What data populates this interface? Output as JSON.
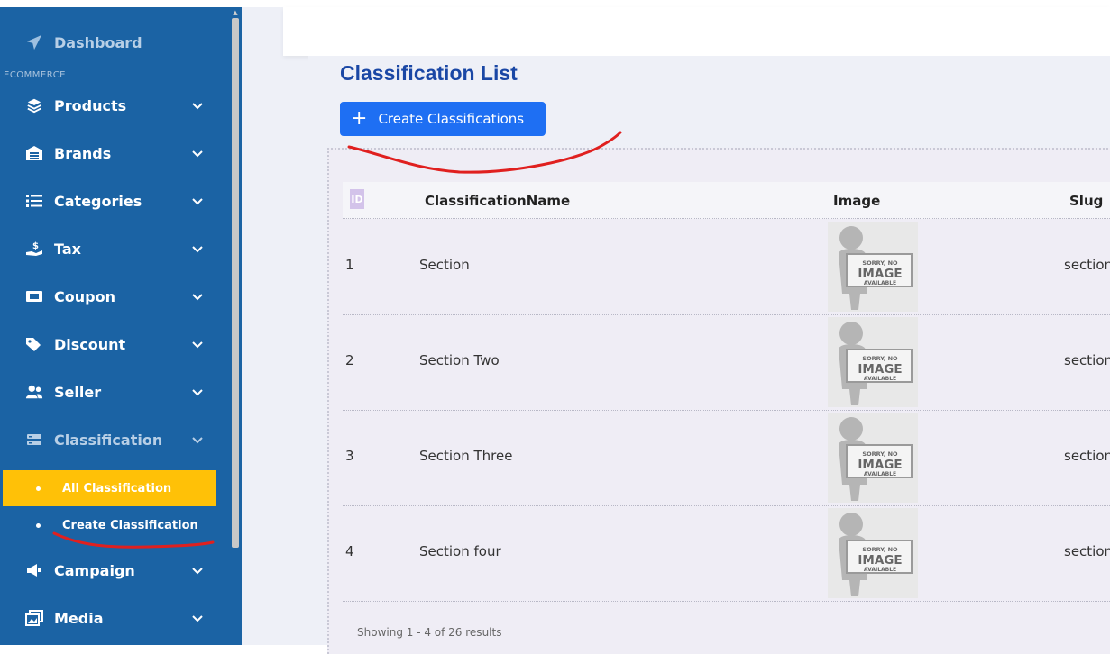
{
  "sidebar": {
    "dashboard": "Dashboard",
    "section": "ECOMMERCE",
    "items": [
      {
        "label": "Products",
        "icon": "layers-icon"
      },
      {
        "label": "Brands",
        "icon": "warehouse-icon"
      },
      {
        "label": "Categories",
        "icon": "list-icon"
      },
      {
        "label": "Tax",
        "icon": "hand-dollar-icon"
      },
      {
        "label": "Coupon",
        "icon": "ticket-icon"
      },
      {
        "label": "Discount",
        "icon": "tags-icon"
      },
      {
        "label": "Seller",
        "icon": "users-icon"
      },
      {
        "label": "Classification",
        "icon": "server-icon"
      },
      {
        "label": "Campaign",
        "icon": "megaphone-icon"
      },
      {
        "label": "Media",
        "icon": "images-icon"
      }
    ],
    "sub_items": [
      "All Classification",
      "Create Classification"
    ]
  },
  "page": {
    "title": "Classification List",
    "create_button": "Create Classifications"
  },
  "table": {
    "columns": [
      "ID",
      "ClassificationName",
      "Image",
      "Slug"
    ],
    "rows": [
      {
        "id": "1",
        "name": "Section",
        "slug": "section"
      },
      {
        "id": "2",
        "name": "Section Two",
        "slug": "section"
      },
      {
        "id": "3",
        "name": "Section Three",
        "slug": "section"
      },
      {
        "id": "4",
        "name": "Section four",
        "slug": "section"
      }
    ],
    "placeholder": {
      "line1": "SORRY, NO",
      "line2": "IMAGE",
      "line3": "AVAILABLE"
    },
    "footer": "Showing 1 - 4 of 26 results"
  },
  "colors": {
    "sidebar": "#1b63a4",
    "active_item": "#ffc107",
    "accent_button": "#1e6ff3",
    "title": "#1a47a5",
    "annotation": "#e0201f"
  }
}
